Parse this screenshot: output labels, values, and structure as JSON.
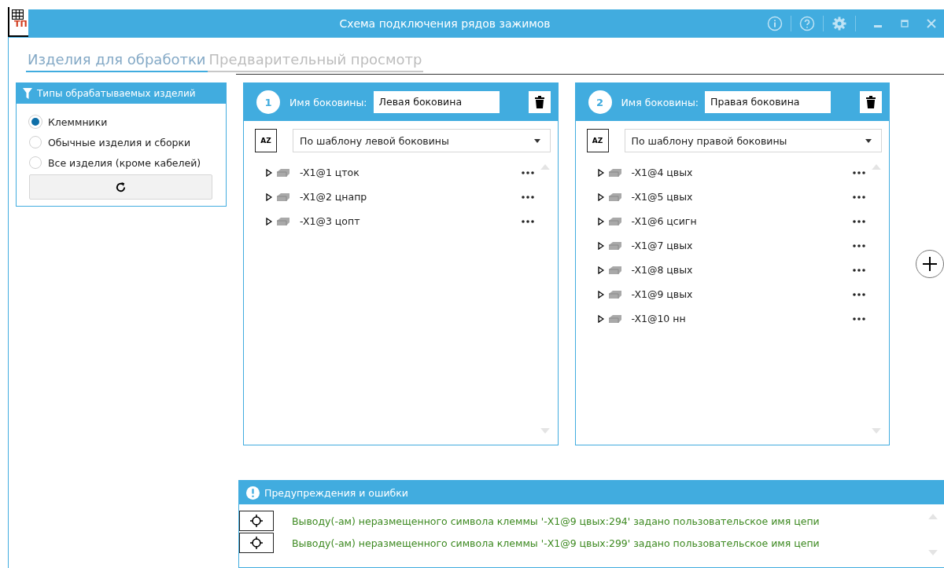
{
  "window": {
    "title": "Схема подключения рядов зажимов",
    "logo_text": "ТП"
  },
  "tabs": [
    {
      "label": "Изделия для обработки",
      "selected": true
    },
    {
      "label": "Предварительный просмотр",
      "selected": false
    }
  ],
  "filter_panel": {
    "title": "Типы обрабатываемых изделий",
    "options": [
      {
        "label": "Клеммники",
        "selected": true
      },
      {
        "label": "Обычные изделия и сборки",
        "selected": false
      },
      {
        "label": "Все изделия (кроме кабелей)",
        "selected": false
      }
    ]
  },
  "sides": [
    {
      "number": "1",
      "name_label": "Имя боковины:",
      "name_value": "Левая боковина",
      "sort_label": "AZ",
      "template": "По шаблону левой боковины",
      "items": [
        {
          "label": "-X1@1 цток",
          "expanded": false
        },
        {
          "label": "-X1@2 цнапр",
          "expanded": false
        },
        {
          "label": "-X1@3 цопт",
          "expanded": false
        }
      ]
    },
    {
      "number": "2",
      "name_label": "Имя боковины:",
      "name_value": "Правая боковина",
      "sort_label": "AZ",
      "template": "По шаблону правой боковины",
      "items": [
        {
          "label": "-X1@4 цвых",
          "expanded": false
        },
        {
          "label": "-X1@5 цвых",
          "expanded": false
        },
        {
          "label": "-X1@6 цсигн",
          "expanded": false
        },
        {
          "label": "-X1@7 цвых",
          "expanded": false
        },
        {
          "label": "-X1@8 цвых",
          "expanded": false
        },
        {
          "label": "-X1@9 цвых",
          "expanded": false
        },
        {
          "label": "-X1@10 нн",
          "expanded": false
        }
      ]
    }
  ],
  "warnings": {
    "title": "Предупреждения и ошибки",
    "messages": [
      {
        "text": "Выводу(-ам) неразмещенного символа клеммы '-X1@9 цвых:294' задано пользовательское имя цепи"
      },
      {
        "text": "Выводу(-ам) неразмещенного символа клеммы '-X1@9 цвых:299' задано пользовательское имя цепи"
      }
    ]
  }
}
